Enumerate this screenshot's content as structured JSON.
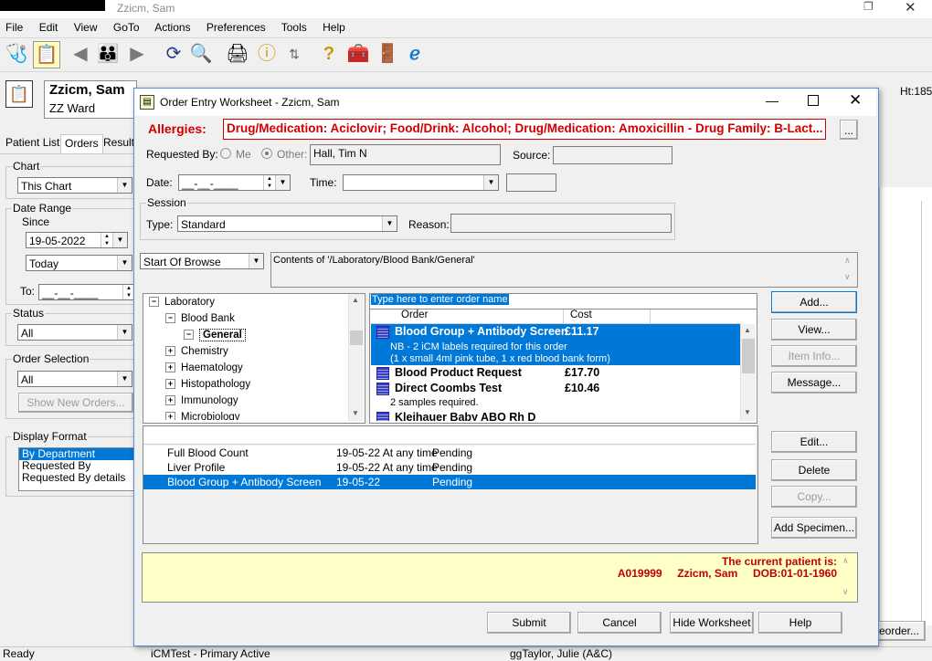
{
  "app": {
    "title": "Zzicm, Sam"
  },
  "menu": [
    "File",
    "Edit",
    "View",
    "GoTo",
    "Actions",
    "Preferences",
    "Tools",
    "Help"
  ],
  "patient_header": {
    "name": "Zzicm, Sam",
    "ward": "ZZ Ward",
    "ht": "Ht:185"
  },
  "left_panel": {
    "tabs": [
      "Patient List",
      "Orders",
      "Results"
    ],
    "chart": {
      "label": "Chart",
      "value": "This Chart"
    },
    "date_range": {
      "label": "Date Range",
      "since_label": "Since",
      "since_value": "19-05-2022",
      "today_value": "Today",
      "to_label": "To:",
      "to_value": "__-__-____"
    },
    "status": {
      "label": "Status",
      "value": "All"
    },
    "order_selection": {
      "label": "Order Selection",
      "value": "All",
      "show_new": "Show New Orders..."
    },
    "display_format": {
      "label": "Display Format",
      "options": [
        "By Department",
        "Requested By",
        "Requested By details"
      ]
    }
  },
  "dialog": {
    "title": "Order Entry Worksheet - Zzicm, Sam",
    "allergies_label": "Allergies:",
    "allergies_text": "Drug/Medication: Aciclovir; Food/Drink: Alcohol; Drug/Medication: Amoxicillin - Drug Family: B-Lact...",
    "allergies_btn": "...",
    "requested_by_label": "Requested By:",
    "me_label": "Me",
    "other_label": "Other:",
    "other_value": "Hall, Tim N",
    "source_label": "Source:",
    "date_label": "Date:",
    "date_value": "__-__-____",
    "time_label": "Time:",
    "session_label": "Session",
    "type_label": "Type:",
    "type_value": "Standard",
    "reason_label": "Reason:",
    "browse_value": "Start Of Browse",
    "contents_text": "Contents of '/Laboratory/Blood Bank/General'",
    "tree": [
      {
        "label": "Laboratory",
        "sign": "−"
      },
      {
        "label": "Blood Bank",
        "sign": "−"
      },
      {
        "label": "General",
        "sign": "−"
      },
      {
        "label": "Chemistry",
        "sign": "+"
      },
      {
        "label": "Haematology",
        "sign": "+"
      },
      {
        "label": "Histopathology",
        "sign": "+"
      },
      {
        "label": "Immunology",
        "sign": "+"
      },
      {
        "label": "Microbiology",
        "sign": "+"
      }
    ],
    "order_search_placeholder": "Type here to enter order name",
    "order_columns": [
      "Order",
      "Cost"
    ],
    "orders": [
      {
        "name": "Blood Group + Antibody Screen",
        "cost": "£11.17",
        "note1": "NB - 2 iCM labels required for this order",
        "note2": "(1 x small 4ml pink tube, 1 x red blood bank form)"
      },
      {
        "name": "Blood Product Request",
        "cost": "£17.70"
      },
      {
        "name": "Direct Coombs Test",
        "cost": "£10.46",
        "note1": "2 samples required."
      },
      {
        "name": "Kleihauer Baby ABO Rh D",
        "cost": ""
      }
    ],
    "right_buttons": [
      "Add...",
      "View...",
      "Item Info...",
      "Message..."
    ],
    "worklist": [
      {
        "order": "Full Blood Count",
        "date": "19-05-22 At any time",
        "status": "Pending"
      },
      {
        "order": "Liver Profile",
        "date": "19-05-22 At any time",
        "status": "Pending"
      },
      {
        "order": "Blood Group + Antibody Screen",
        "date": "19-05-22",
        "status": "Pending"
      }
    ],
    "worklist_buttons": [
      "Edit...",
      "Delete",
      "Copy...",
      "Add Specimen..."
    ],
    "patient_info_line1": "The current patient is:",
    "patient_info_line2": "A019999     Zzicm, Sam     DOB:01-01-1960",
    "bottom_buttons": [
      "Submit",
      "Cancel",
      "Hide Worksheet",
      "Help"
    ]
  },
  "behind": {
    "reorder": "eorder..."
  },
  "statusbar": [
    "Ready",
    "iCMTest - Primary Active",
    "ggTaylor, Julie  (A&C)"
  ]
}
